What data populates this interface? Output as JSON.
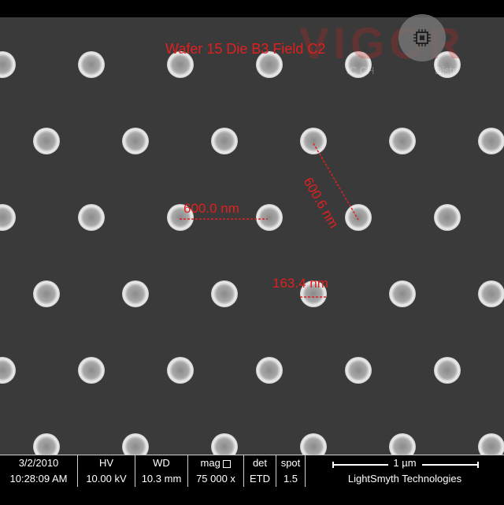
{
  "overlay": {
    "title": "Wafer 15 Die B3 Field C2",
    "measurement_1": "600.0 nm",
    "measurement_2": "600.6 nm",
    "measurement_3": "163.4 nm",
    "watermark": "VIGOR",
    "watermark_sub_left": "IC CH",
    "watermark_sub_right": "Distr",
    "chip_icon": "chip-icon",
    "annotation_color": "#e02020"
  },
  "infobar": {
    "date_label": "3/2/2010",
    "time_value": "10:28:09 AM",
    "hv_label": "HV",
    "hv_value": "10.00 kV",
    "wd_label": "WD",
    "wd_value": "10.3 mm",
    "mag_label": "mag",
    "mag_value": "75 000 x",
    "det_label": "det",
    "det_value": "ETD",
    "spot_label": "spot",
    "spot_value": "1.5",
    "scale_label": "1 µm",
    "company": "LightSmyth Technologies"
  }
}
